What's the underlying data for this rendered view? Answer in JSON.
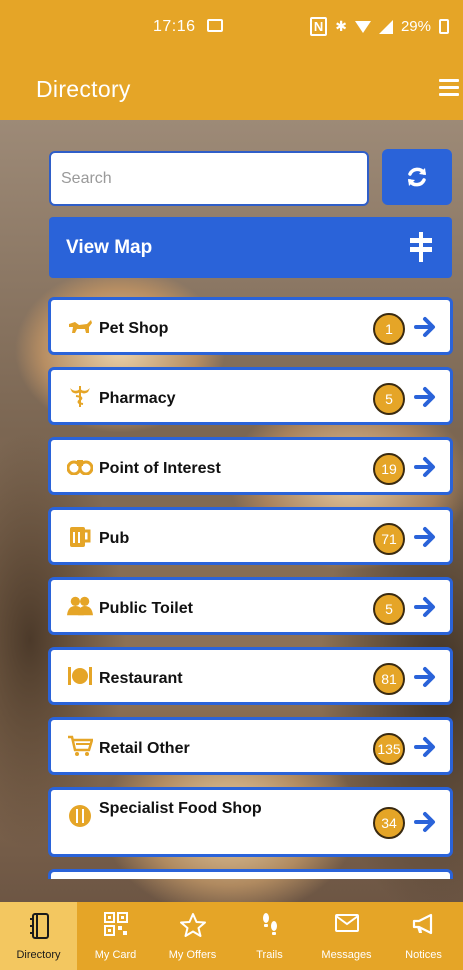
{
  "status": {
    "time": "17:16",
    "battery": "29%"
  },
  "appbar": {
    "title": "Directory"
  },
  "search": {
    "placeholder": "Search",
    "value": ""
  },
  "viewmap": {
    "label": "View Map"
  },
  "categories": [
    {
      "label": "Pet Shop",
      "count": "1",
      "icon": "dog-icon"
    },
    {
      "label": "Pharmacy",
      "count": "5",
      "icon": "caduceus-icon"
    },
    {
      "label": "Point of Interest",
      "count": "19",
      "icon": "binoculars-icon"
    },
    {
      "label": "Pub",
      "count": "71",
      "icon": "beer-mug-icon"
    },
    {
      "label": "Public Toilet",
      "count": "5",
      "icon": "people-icon"
    },
    {
      "label": "Restaurant",
      "count": "81",
      "icon": "plate-cutlery-icon"
    },
    {
      "label": "Retail Other",
      "count": "135",
      "icon": "shopping-cart-icon"
    },
    {
      "label": "Specialist Food Shop",
      "count": "34",
      "icon": "food-shop-icon"
    }
  ],
  "nav": [
    {
      "label": "Directory",
      "icon": "directory-book-icon",
      "active": true
    },
    {
      "label": "My Card",
      "icon": "qr-code-icon"
    },
    {
      "label": "My Offers",
      "icon": "star-icon"
    },
    {
      "label": "Trails",
      "icon": "footprints-icon"
    },
    {
      "label": "Messages",
      "icon": "envelope-icon"
    },
    {
      "label": "Notices",
      "icon": "megaphone-icon"
    }
  ],
  "colors": {
    "primary": "#e5a527",
    "accent": "#2a63d9",
    "active_tab": "#f3c760"
  }
}
